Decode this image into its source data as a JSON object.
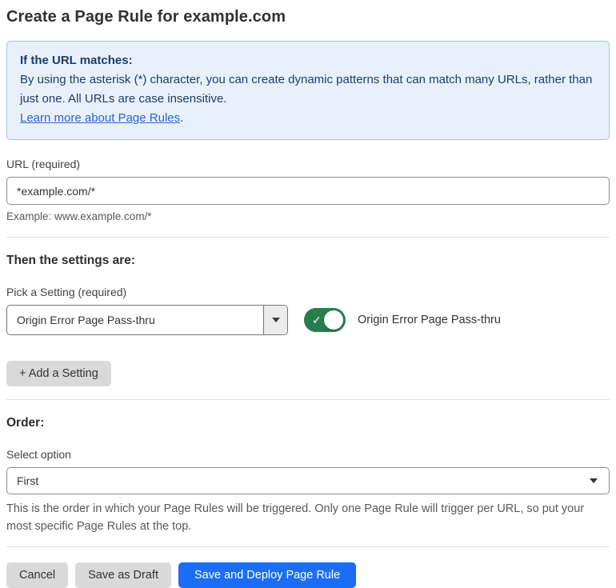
{
  "page": {
    "title": "Create a Page Rule for example.com"
  },
  "info_box": {
    "heading": "If the URL matches:",
    "body": "By using the asterisk (*) character, you can create dynamic patterns that can match many URLs, rather than just one. All URLs are case insensitive.",
    "link_label": "Learn more about Page Rules",
    "link_suffix": "."
  },
  "url_field": {
    "label": "URL (required)",
    "value": "*example.com/*",
    "example": "Example: www.example.com/*"
  },
  "settings_section": {
    "heading": "Then the settings are:",
    "picker_label": "Pick a Setting (required)",
    "picker_value": "Origin Error Page Pass-thru",
    "toggle_label": "Origin Error Page Pass-thru",
    "toggle_state": "on",
    "add_setting_label": "+ Add a Setting"
  },
  "order_section": {
    "heading": "Order:",
    "select_label": "Select option",
    "select_value": "First",
    "help_text": "This is the order in which your Page Rules will be triggered. Only one Page Rule will trigger per URL, so put your most specific Page Rules at the top."
  },
  "footer": {
    "cancel_label": "Cancel",
    "save_draft_label": "Save as Draft",
    "save_deploy_label": "Save and Deploy Page Rule"
  },
  "icons": {
    "toggle_check": "✓"
  },
  "colors": {
    "accent_blue": "#1a6ef5",
    "toggle_green": "#287d4e",
    "info_background": "#e8f1fb",
    "info_border": "#9fc5e8",
    "info_text": "#1d3c6e",
    "link_blue": "#2c62d9"
  }
}
